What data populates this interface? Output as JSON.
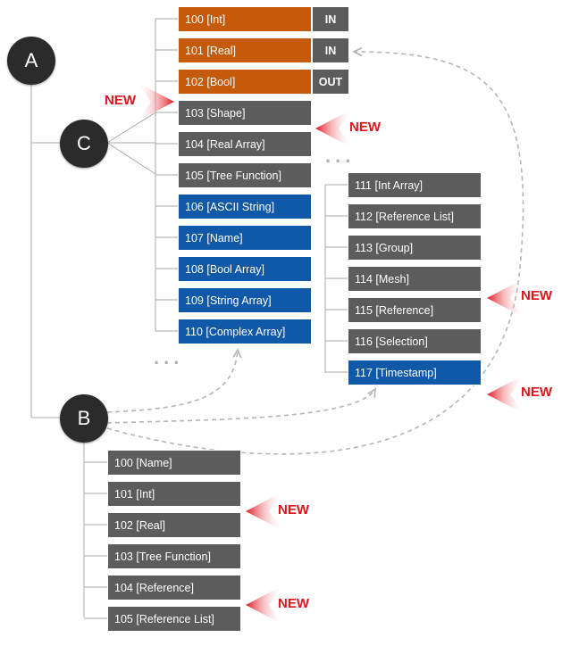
{
  "root": {
    "label": "A"
  },
  "c_node": {
    "label": "C",
    "items": [
      {
        "code": "100",
        "type": "[Int]",
        "color": "#c45a0a",
        "io": "IN"
      },
      {
        "code": "101",
        "type": "[Real]",
        "color": "#c45a0a",
        "io": "IN"
      },
      {
        "code": "102",
        "type": "[Bool]",
        "color": "#c45a0a",
        "io": "OUT"
      },
      {
        "code": "103",
        "type": "[Shape]",
        "color": "#5c5c5c"
      },
      {
        "code": "104",
        "type": "[Real Array]",
        "color": "#5c5c5c"
      },
      {
        "code": "105",
        "type": "[Tree Function]",
        "color": "#5c5c5c"
      },
      {
        "code": "106",
        "type": "[ASCII String]",
        "color": "#1058a8"
      },
      {
        "code": "107",
        "type": "[Name]",
        "color": "#1058a8"
      },
      {
        "code": "108",
        "type": "[Bool Array]",
        "color": "#1058a8"
      },
      {
        "code": "109",
        "type": "[String Array]",
        "color": "#1058a8"
      },
      {
        "code": "110",
        "type": "[Complex Array]",
        "color": "#1058a8"
      }
    ],
    "ellipsis": "...",
    "continued_items": [
      {
        "code": "111",
        "type": "[Int Array]",
        "color": "#5c5c5c"
      },
      {
        "code": "112",
        "type": "[Reference List]",
        "color": "#5c5c5c"
      },
      {
        "code": "113",
        "type": "[Group]",
        "color": "#5c5c5c"
      },
      {
        "code": "114",
        "type": "[Mesh]",
        "color": "#5c5c5c"
      },
      {
        "code": "115",
        "type": "[Reference]",
        "color": "#5c5c5c"
      },
      {
        "code": "116",
        "type": "[Selection]",
        "color": "#5c5c5c"
      },
      {
        "code": "117",
        "type": "[Timestamp]",
        "color": "#1058a8"
      }
    ],
    "continued_ellipsis": "..."
  },
  "b_node": {
    "label": "B",
    "items": [
      {
        "code": "100",
        "type": "[Name]",
        "color": "#5c5c5c"
      },
      {
        "code": "101",
        "type": "[Int]",
        "color": "#5c5c5c"
      },
      {
        "code": "102",
        "type": "[Real]",
        "color": "#5c5c5c"
      },
      {
        "code": "103",
        "type": "[Tree Function]",
        "color": "#5c5c5c"
      },
      {
        "code": "104",
        "type": "[Reference]",
        "color": "#5c5c5c"
      },
      {
        "code": "105",
        "type": "[Reference List]",
        "color": "#5c5c5c"
      }
    ]
  },
  "new_tags": [
    {
      "text": "NEW"
    },
    {
      "text": "NEW"
    },
    {
      "text": "NEW"
    },
    {
      "text": "NEW"
    },
    {
      "text": "NEW"
    },
    {
      "text": "NEW"
    }
  ],
  "colors": {
    "node": "#2b2b2b",
    "gray": "#5c5c5c",
    "orange": "#c45a0a",
    "blue": "#1058a8",
    "accent_red": "#e0141c",
    "dashed": "#b5b5b5"
  }
}
